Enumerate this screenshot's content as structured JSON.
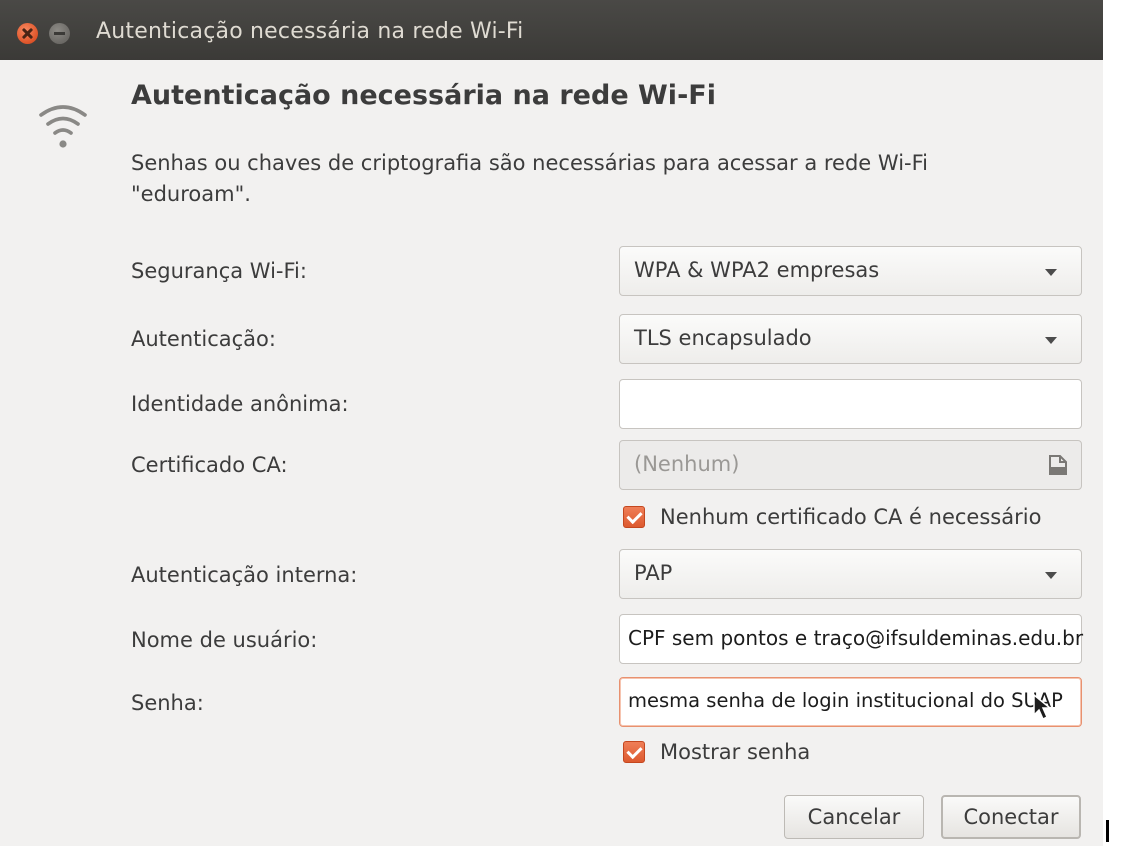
{
  "window": {
    "title": "Autenticação necessária na rede Wi-Fi"
  },
  "dialog": {
    "heading": "Autenticação necessária na rede Wi-Fi",
    "description": "Senhas ou chaves de criptografia são necessárias para acessar a rede Wi-Fi \"eduroam\".",
    "icon": "wifi-icon"
  },
  "form": {
    "security": {
      "label": "Segurança Wi-Fi:",
      "value": "WPA & WPA2 empresas"
    },
    "authentication": {
      "label": "Autenticação:",
      "value": "TLS encapsulado"
    },
    "anonymous_identity": {
      "label": "Identidade anônima:",
      "value": ""
    },
    "ca_certificate": {
      "label": "Certificado CA:",
      "value": "(Nenhum)",
      "icon": "file-icon"
    },
    "no_ca_required": {
      "label": "Nenhum certificado CA é necessário",
      "checked": true
    },
    "inner_authentication": {
      "label": "Autenticação interna:",
      "value": "PAP"
    },
    "username": {
      "label": "Nome de usuário:",
      "value": "CPF sem pontos e traço@ifsuldeminas.edu.br"
    },
    "password": {
      "label": "Senha:",
      "value": "mesma senha de login institucional do SUAP"
    },
    "show_password": {
      "label": "Mostrar senha",
      "checked": true
    }
  },
  "buttons": {
    "cancel": "Cancelar",
    "connect": "Conectar"
  },
  "colors": {
    "titlebar": "#3b3a37",
    "window_bg": "#f2f1f0",
    "accent": "#e0572c"
  }
}
